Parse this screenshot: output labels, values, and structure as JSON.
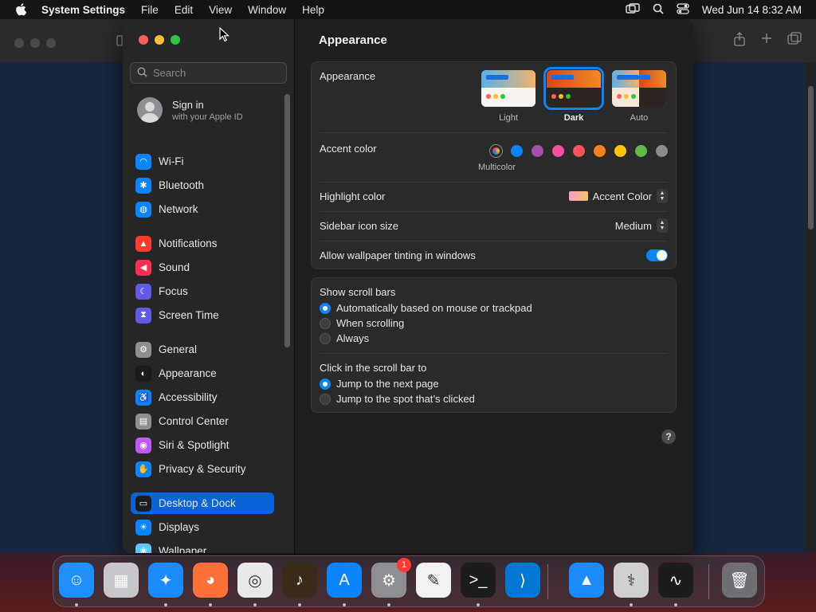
{
  "menubar": {
    "app_name": "System Settings",
    "items": [
      "File",
      "Edit",
      "View",
      "Window",
      "Help"
    ],
    "clock": "Wed Jun 14  8:32 AM"
  },
  "sidebar": {
    "search_placeholder": "Search",
    "signin_title": "Sign in",
    "signin_subtitle": "with your Apple ID",
    "items": [
      {
        "label": "Wi-Fi",
        "icon": "wifi-icon",
        "color": "#0a84ff",
        "glyph": "◠"
      },
      {
        "label": "Bluetooth",
        "icon": "bluetooth-icon",
        "color": "#0a84ff",
        "glyph": "✱"
      },
      {
        "label": "Network",
        "icon": "globe-icon",
        "color": "#0a84ff",
        "glyph": "◍"
      },
      {
        "label": "Notifications",
        "icon": "bell-icon",
        "color": "#ff3b30",
        "glyph": "▲"
      },
      {
        "label": "Sound",
        "icon": "speaker-icon",
        "color": "#ff2d55",
        "glyph": "◀"
      },
      {
        "label": "Focus",
        "icon": "moon-icon",
        "color": "#5e5ce6",
        "glyph": "☾"
      },
      {
        "label": "Screen Time",
        "icon": "hourglass-icon",
        "color": "#5e5ce6",
        "glyph": "⧗"
      },
      {
        "label": "General",
        "icon": "gear-icon",
        "color": "#8e8e93",
        "glyph": "⚙"
      },
      {
        "label": "Appearance",
        "icon": "appearance-icon",
        "color": "#1c1c1e",
        "glyph": "◐"
      },
      {
        "label": "Accessibility",
        "icon": "accessibility-icon",
        "color": "#0a84ff",
        "glyph": "♿"
      },
      {
        "label": "Control Center",
        "icon": "control-center-icon",
        "color": "#8e8e93",
        "glyph": "▤"
      },
      {
        "label": "Siri & Spotlight",
        "icon": "siri-icon",
        "color": "#bf5af2",
        "glyph": "◉"
      },
      {
        "label": "Privacy & Security",
        "icon": "hand-icon",
        "color": "#0a84ff",
        "glyph": "✋"
      },
      {
        "label": "Desktop & Dock",
        "icon": "desktop-dock-icon",
        "color": "#1c1c1e",
        "glyph": "▭",
        "selected": true
      },
      {
        "label": "Displays",
        "icon": "display-icon",
        "color": "#0a84ff",
        "glyph": "☀"
      },
      {
        "label": "Wallpaper",
        "icon": "wallpaper-icon",
        "color": "#5ac8fa",
        "glyph": "❀"
      }
    ]
  },
  "main": {
    "title": "Appearance",
    "appearance_label": "Appearance",
    "appearance_options": [
      "Light",
      "Dark",
      "Auto"
    ],
    "appearance_selected": "Dark",
    "accent_label": "Accent color",
    "accent_selected_name": "Multicolor",
    "accent_colors": [
      "multicolor",
      "#0a84ff",
      "#a550a7",
      "#f74f9e",
      "#ff5257",
      "#f7821b",
      "#ffc600",
      "#62ba46",
      "#8c8c8c"
    ],
    "highlight_label": "Highlight color",
    "highlight_value": "Accent Color",
    "sidebar_icon_label": "Sidebar icon size",
    "sidebar_icon_value": "Medium",
    "tinting_label": "Allow wallpaper tinting in windows",
    "tinting_on": true,
    "scroll_title": "Show scroll bars",
    "scroll_options": [
      "Automatically based on mouse or trackpad",
      "When scrolling",
      "Always"
    ],
    "scroll_selected": 0,
    "click_title": "Click in the scroll bar to",
    "click_options": [
      "Jump to the next page",
      "Jump to the spot that’s clicked"
    ],
    "click_selected": 0,
    "help_glyph": "?"
  },
  "dock": {
    "apps": [
      {
        "name": "finder",
        "color": "#1e90ff",
        "glyph": "☺"
      },
      {
        "name": "launchpad",
        "color": "#c7c7cc",
        "glyph": "▦"
      },
      {
        "name": "safari",
        "color": "#1a8cff",
        "glyph": "✦"
      },
      {
        "name": "firefox",
        "color": "#ff7139",
        "glyph": "◕"
      },
      {
        "name": "chrome",
        "color": "#e8e8e8",
        "glyph": "◎"
      },
      {
        "name": "garageband",
        "color": "#3a2a1a",
        "glyph": "♪"
      },
      {
        "name": "app-store",
        "color": "#0a84ff",
        "glyph": "A"
      },
      {
        "name": "system-settings",
        "color": "#8e8e93",
        "glyph": "⚙",
        "badge": "1"
      },
      {
        "name": "textedit",
        "color": "#f2f2f2",
        "glyph": "✎"
      },
      {
        "name": "terminal",
        "color": "#1c1c1e",
        "glyph": ">_"
      },
      {
        "name": "vscode",
        "color": "#0078d4",
        "glyph": "⟩"
      },
      {
        "name": "keynote",
        "color": "#1a8cff",
        "glyph": "▲"
      },
      {
        "name": "disk-utility",
        "color": "#d0d0d0",
        "glyph": "⚕"
      },
      {
        "name": "activity-monitor",
        "color": "#1c1c1e",
        "glyph": "∿"
      },
      {
        "name": "trash",
        "color": "#6e6e73",
        "glyph": "🗑"
      }
    ]
  }
}
